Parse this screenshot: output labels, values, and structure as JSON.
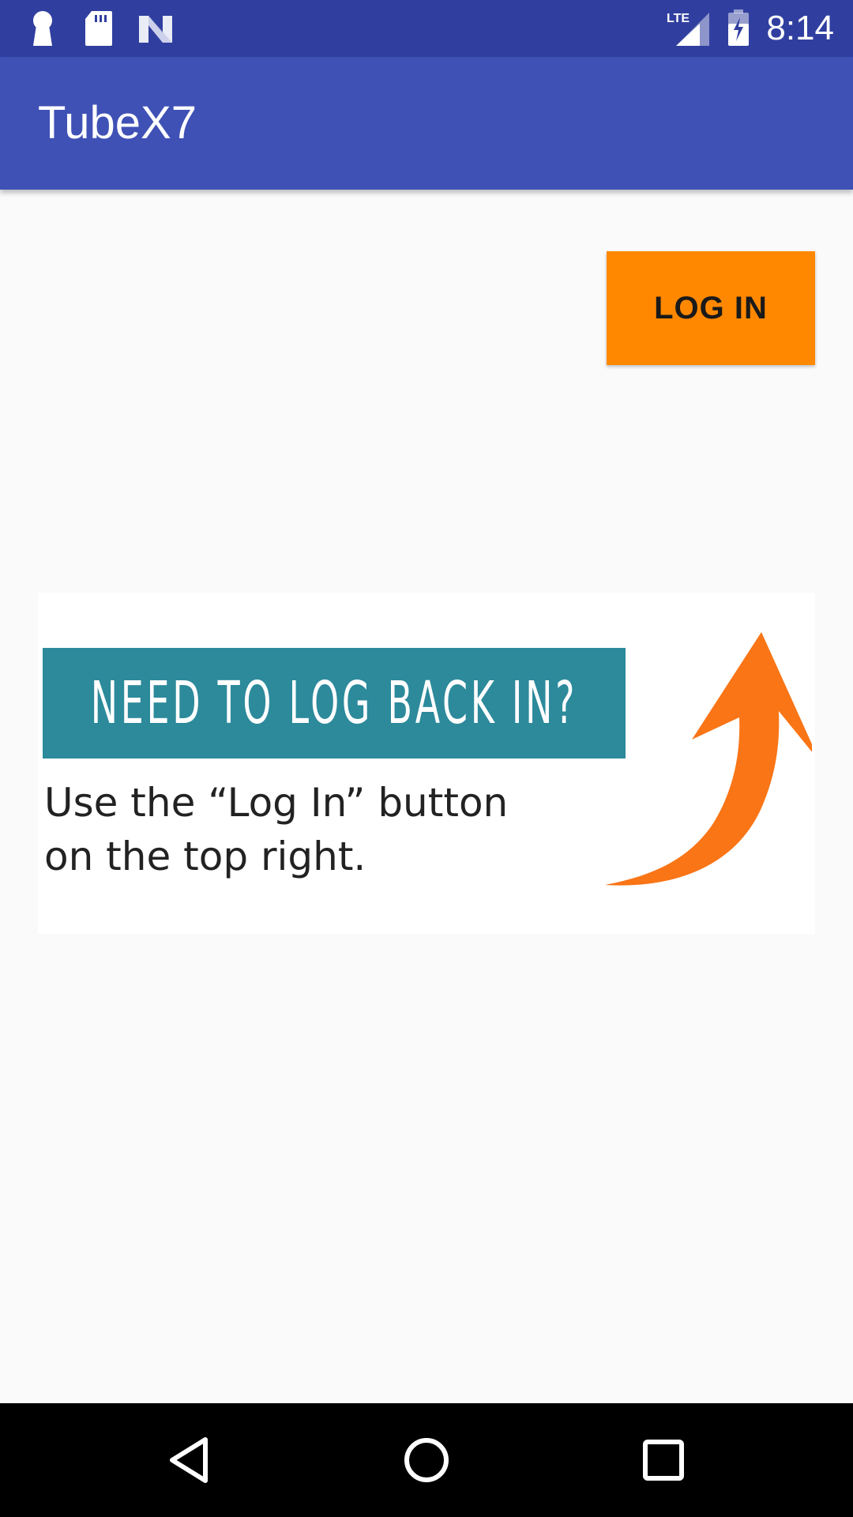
{
  "status_bar": {
    "time": "8:14",
    "left_icons": [
      "keyhole-icon",
      "sd-card-icon",
      "n-logo-icon"
    ],
    "right_icons": [
      "lte-signal-icon",
      "battery-charging-icon"
    ],
    "lte_label": "LTE"
  },
  "app_bar": {
    "title": "TubeX7",
    "color": "#3f51b5"
  },
  "main": {
    "login_button_label": "LOG IN",
    "login_button_color": "#ff8800",
    "banner": {
      "headline": "NEED TO LOG BACK IN?",
      "subtext_line1": "Use the “Log In” button",
      "subtext_line2": "on the top right.",
      "headline_bg": "#2c8a9b",
      "arrow_color": "#f97516"
    }
  },
  "nav_bar": {
    "buttons": [
      "back-icon",
      "home-icon",
      "recents-icon"
    ]
  }
}
